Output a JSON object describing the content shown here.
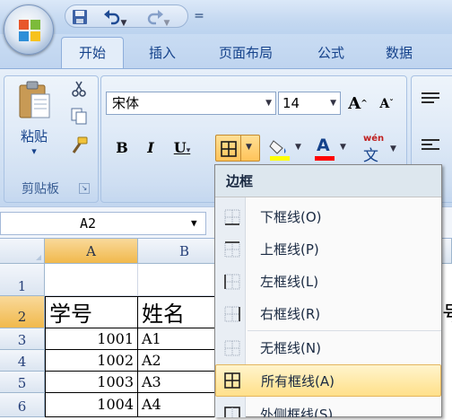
{
  "quick_access": {
    "save_icon": "save-icon",
    "undo_icon": "undo-icon",
    "redo_icon": "redo-icon",
    "customize_glyph": "="
  },
  "tabs": [
    {
      "label": "开始",
      "active": true
    },
    {
      "label": "插入"
    },
    {
      "label": "页面布局"
    },
    {
      "label": "公式"
    },
    {
      "label": "数据"
    }
  ],
  "clipboard": {
    "paste_label": "粘贴",
    "group_label": "剪贴板",
    "dropdown_glyph": "▾"
  },
  "font": {
    "name": "宋体",
    "size": "14",
    "grow_label": "A",
    "shrink_label": "A",
    "bold_label": "B",
    "italic_label": "I",
    "underline_label": "U",
    "fill_color": "#ffff00",
    "font_color": "#ff0000",
    "phonetic_top": "wén",
    "phonetic_char": "文"
  },
  "formula_bar": {
    "name_box": "A2"
  },
  "grid": {
    "columns": [
      "A",
      "B"
    ],
    "rows": [
      "1",
      "2",
      "3",
      "4",
      "5",
      "6"
    ],
    "header_row": [
      "学号",
      "姓名"
    ],
    "data": [
      [
        "1001",
        "A1"
      ],
      [
        "1002",
        "A2"
      ],
      [
        "1003",
        "A3"
      ],
      [
        "1004",
        "A4"
      ]
    ],
    "partial_right": "号"
  },
  "border_menu": {
    "title": "边框",
    "items": [
      {
        "label": "下框线(O)",
        "icon": "bottom-border-icon"
      },
      {
        "label": "上框线(P)",
        "icon": "top-border-icon"
      },
      {
        "label": "左框线(L)",
        "icon": "left-border-icon"
      },
      {
        "label": "右框线(R)",
        "icon": "right-border-icon"
      },
      {
        "label": "无框线(N)",
        "icon": "no-border-icon"
      },
      {
        "label": "所有框线(A)",
        "icon": "all-borders-icon",
        "highlighted": true
      },
      {
        "label": "外侧框线(S)",
        "icon": "outside-borders-icon"
      }
    ]
  }
}
